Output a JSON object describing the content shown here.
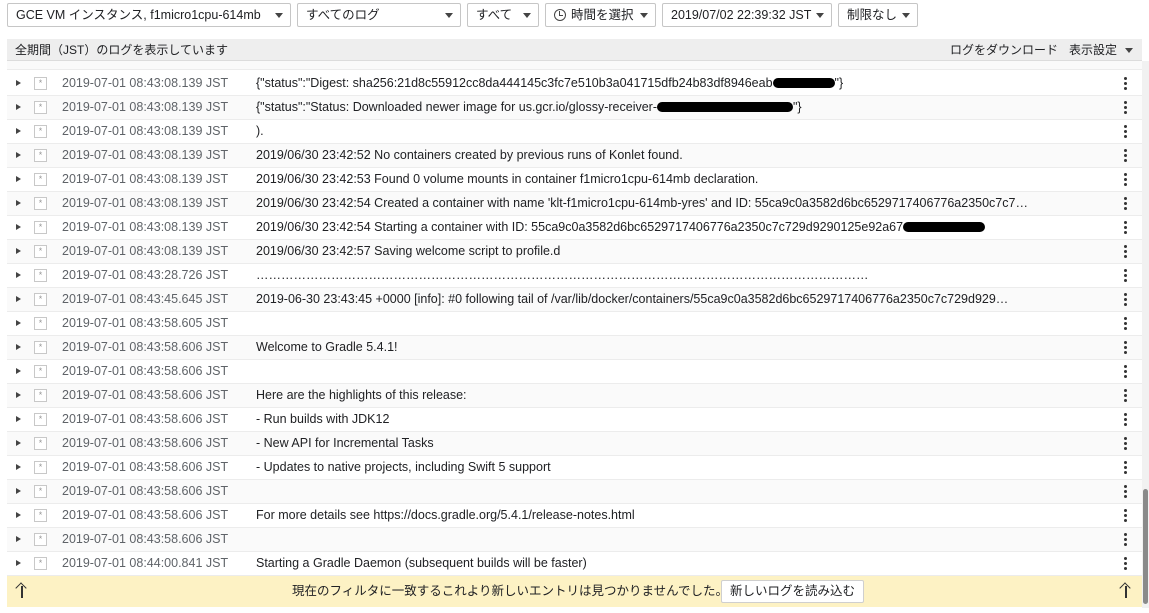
{
  "toolbar": {
    "resource": "GCE VM インスタンス, f1micro1cpu-614mb",
    "log_name": "すべてのログ",
    "severity": "すべて",
    "time_picker": "時間を選択",
    "datetime": "2019/07/02 22:39:32 JST",
    "limit": "制限なし"
  },
  "infobar": {
    "message": "全期間（JST）のログを表示しています",
    "download": "ログをダウンロード",
    "view_settings": "表示設定"
  },
  "severity_glyph": "*",
  "rows": [
    {
      "ts": "2019-07-01 08:43:08.139 JST",
      "msg": "{\"status\":\"Digest: sha256:21d8c55912cc8da444145c3fc7e510b3a041715dfb24b83df8946eab",
      "tail": "\"}",
      "redact": 62
    },
    {
      "ts": "2019-07-01 08:43:08.139 JST",
      "msg": "{\"status\":\"Status: Downloaded newer image for us.gcr.io/glossy-receiver-",
      "tail": "\"}",
      "redact": 136
    },
    {
      "ts": "2019-07-01 08:43:08.139 JST",
      "msg": ")."
    },
    {
      "ts": "2019-07-01 08:43:08.139 JST",
      "msg": "2019/06/30 23:42:52 No containers created by previous runs of Konlet found."
    },
    {
      "ts": "2019-07-01 08:43:08.139 JST",
      "msg": "2019/06/30 23:42:53 Found 0 volume mounts in container f1micro1cpu-614mb declaration."
    },
    {
      "ts": "2019-07-01 08:43:08.139 JST",
      "msg": "2019/06/30 23:42:54 Created a container with name 'klt-f1micro1cpu-614mb-yres' and ID: 55ca9c0a3582d6bc6529717406776a2350c7c7…"
    },
    {
      "ts": "2019-07-01 08:43:08.139 JST",
      "msg": "2019/06/30 23:42:54 Starting a container with ID: 55ca9c0a3582d6bc6529717406776a2350c7c729d9290125e92a67",
      "tail": "",
      "redact": 82
    },
    {
      "ts": "2019-07-01 08:43:08.139 JST",
      "msg": "2019/06/30 23:42:57 Saving welcome script to profile.d"
    },
    {
      "ts": "2019-07-01 08:43:28.726 JST",
      "msg": "…………………………………………………………………………………………………………………………………"
    },
    {
      "ts": "2019-07-01 08:43:45.645 JST",
      "msg": "2019-06-30 23:43:45 +0000 [info]: #0 following tail of /var/lib/docker/containers/55ca9c0a3582d6bc6529717406776a2350c7c729d929…"
    },
    {
      "ts": "2019-07-01 08:43:58.605 JST",
      "msg": ""
    },
    {
      "ts": "2019-07-01 08:43:58.606 JST",
      "msg": "Welcome to Gradle 5.4.1!"
    },
    {
      "ts": "2019-07-01 08:43:58.606 JST",
      "msg": ""
    },
    {
      "ts": "2019-07-01 08:43:58.606 JST",
      "msg": "Here are the highlights of this release:"
    },
    {
      "ts": "2019-07-01 08:43:58.606 JST",
      "msg": "- Run builds with JDK12"
    },
    {
      "ts": "2019-07-01 08:43:58.606 JST",
      "msg": "- New API for Incremental Tasks"
    },
    {
      "ts": "2019-07-01 08:43:58.606 JST",
      "msg": "- Updates to native projects, including Swift 5 support"
    },
    {
      "ts": "2019-07-01 08:43:58.606 JST",
      "msg": ""
    },
    {
      "ts": "2019-07-01 08:43:58.606 JST",
      "msg": "For more details see https://docs.gradle.org/5.4.1/release-notes.html"
    },
    {
      "ts": "2019-07-01 08:43:58.606 JST",
      "msg": ""
    },
    {
      "ts": "2019-07-01 08:44:00.841 JST",
      "msg": "Starting a Gradle Daemon (subsequent builds will be faster)"
    }
  ],
  "footer": {
    "message": "現在のフィルタに一致するこれより新しいエントリは見つかりませんでした。",
    "load_newer": "新しいログを読み込む"
  }
}
